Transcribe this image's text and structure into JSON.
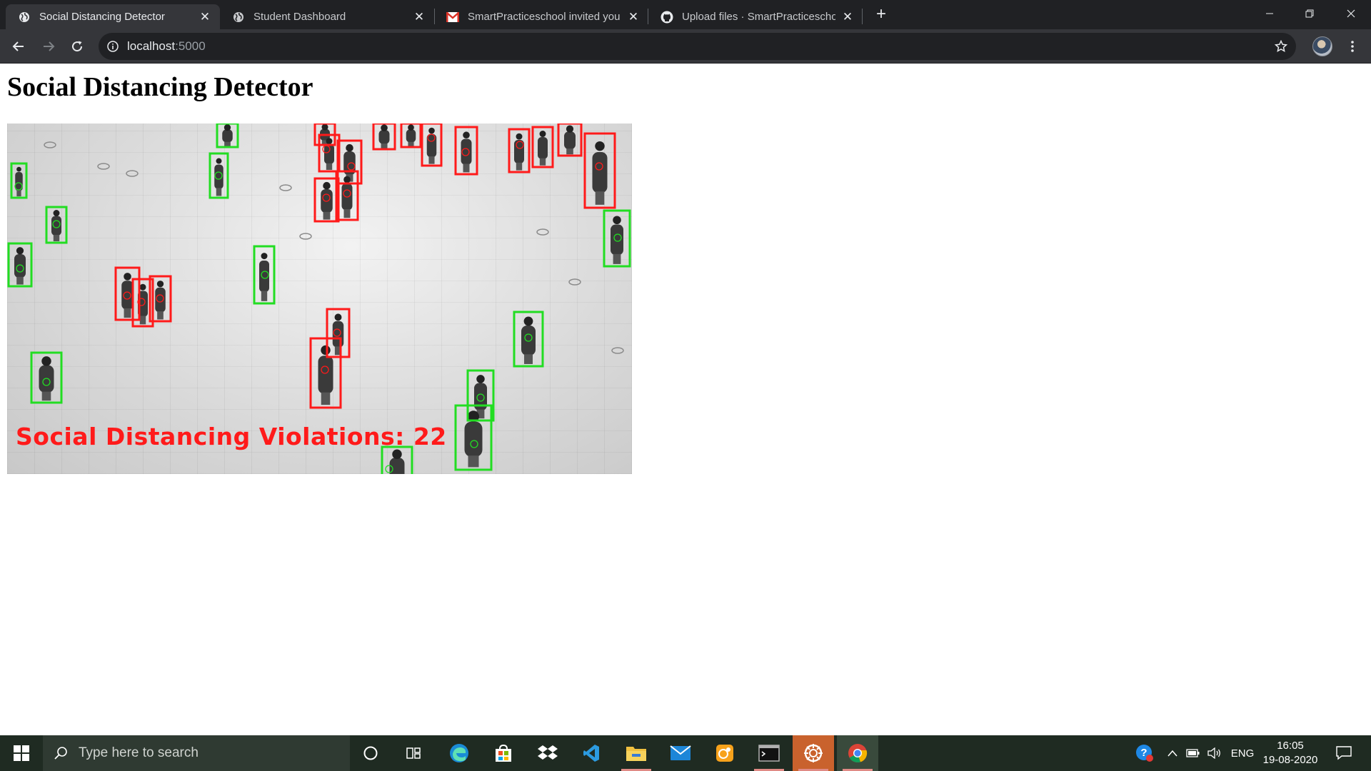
{
  "browser": {
    "tabs": [
      {
        "title": "Social Distancing Detector",
        "favicon": "globe-icon",
        "active": true
      },
      {
        "title": "Student Dashboard",
        "favicon": "globe-icon",
        "active": false
      },
      {
        "title": "SmartPracticeschool invited you t",
        "favicon": "gmail-icon",
        "active": false
      },
      {
        "title": "Upload files · SmartPracticeschool",
        "favicon": "github-icon",
        "active": false
      }
    ],
    "close_glyph": "✕",
    "new_tab_glyph": "+",
    "address": {
      "host": "localhost",
      "port": ":5000"
    }
  },
  "page": {
    "title": "Social Distancing Detector",
    "feed": {
      "violations_text": "Social Distancing Violations: 22",
      "box_colors": {
        "violation": "#ff1a1a",
        "safe": "#22dd22"
      }
    }
  },
  "taskbar": {
    "search_placeholder": "Type here to search",
    "apps": [
      "cortana-icon",
      "task-view-icon",
      "edge-icon",
      "store-icon",
      "dropbox-icon",
      "vscode-icon",
      "file-explorer-icon",
      "mail-icon",
      "photo-app-icon",
      "terminal-icon",
      "anaconda-icon",
      "chrome-icon"
    ],
    "tray": {
      "language": "ENG",
      "time": "16:05",
      "date": "19-08-2020"
    }
  },
  "colors": {
    "titlebar": "#202124",
    "toolbar": "#35363a",
    "taskbar": "#1f2b22",
    "accent_running": "#e08a85"
  }
}
